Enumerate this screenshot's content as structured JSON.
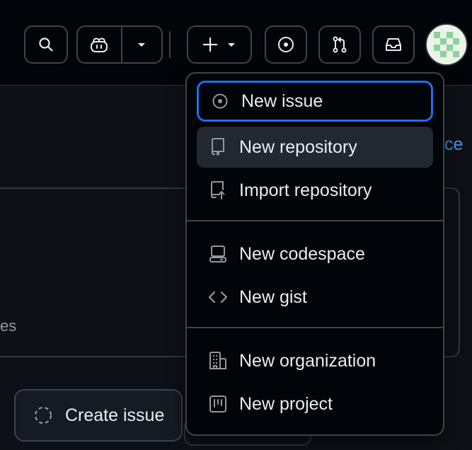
{
  "header": {
    "buttons": [
      {
        "icon": "search-icon"
      },
      {
        "icon": "copilot-icon"
      },
      {
        "icon": "chevron-down-icon"
      },
      {
        "icon": "plus-icon"
      },
      {
        "icon": "issue-circle-icon"
      },
      {
        "icon": "pull-request-icon"
      },
      {
        "icon": "inbox-icon"
      },
      {
        "icon": "avatar"
      }
    ]
  },
  "background": {
    "link_fragment": "ce",
    "card_fragment": "es",
    "create_issue_label": "Create issue"
  },
  "new_menu": {
    "items": [
      {
        "label": "New issue",
        "icon": "issue-opened-icon",
        "state": "focused"
      },
      {
        "label": "New repository",
        "icon": "repo-icon",
        "state": "hovered"
      },
      {
        "label": "Import repository",
        "icon": "repo-push-icon"
      },
      {
        "label": "New codespace",
        "icon": "codespaces-icon"
      },
      {
        "label": "New gist",
        "icon": "code-icon"
      },
      {
        "label": "New organization",
        "icon": "organization-icon"
      },
      {
        "label": "New project",
        "icon": "project-icon"
      }
    ]
  },
  "colors": {
    "background": "#010409",
    "border": "#3d444d",
    "accent": "#1f6feb",
    "link": "#4493f8",
    "text": "#e6edf3",
    "muted": "#9198a1"
  }
}
